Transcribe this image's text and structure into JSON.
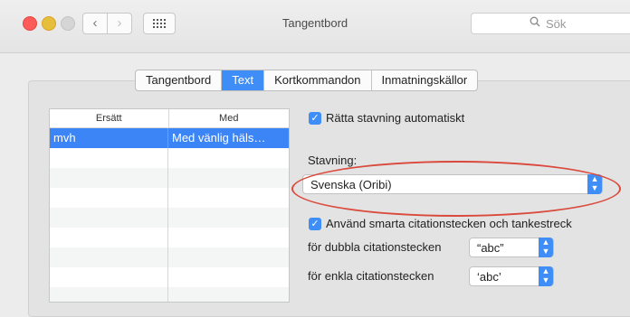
{
  "window": {
    "title": "Tangentbord"
  },
  "search": {
    "placeholder": "Sök"
  },
  "tabs": [
    {
      "label": "Tangentbord"
    },
    {
      "label": "Text"
    },
    {
      "label": "Kortkommandon"
    },
    {
      "label": "Inmatningskällor"
    }
  ],
  "table": {
    "columns": [
      "Ersätt",
      "Med"
    ],
    "rows": [
      {
        "replace": "mvh",
        "with": "Med vänlig häls…"
      }
    ]
  },
  "settings": {
    "autocorrect_label": "Rätta stavning automatiskt",
    "spelling_label": "Stavning:",
    "spelling_value": "Svenska (Oribi)",
    "smart_quotes_label": "Använd smarta citationstecken och tankestreck",
    "double_quotes_label": "för dubbla citationstecken",
    "double_quotes_value": "“abc”",
    "single_quotes_label": "för enkla citationstecken",
    "single_quotes_value": "‘abc’"
  },
  "colors": {
    "accent": "#3f8ef8",
    "highlight": "#d94a3c"
  }
}
